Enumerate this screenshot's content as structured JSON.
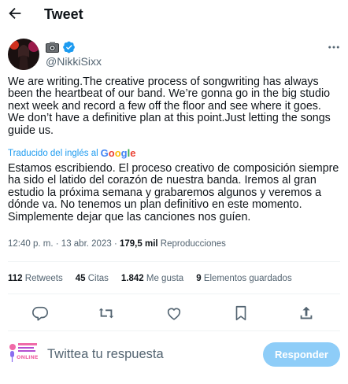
{
  "header": {
    "title": "Tweet"
  },
  "author": {
    "handle": "@NikkiSixx"
  },
  "tweet": {
    "text": "We are writing.The creative process of songwriting has always been the heartbeat of our band. We’re gonna go in the big studio next week and record a few off the floor and see where it goes. We don’t have a definitive plan at this point.Just letting the songs guide us.",
    "translated_label": "Traducido del inglés al",
    "translator": "Google",
    "translation": "Estamos escribiendo. El proceso creativo de composición siempre ha sido el latido del corazón de nuestra banda. Iremos al gran estudio la próxima semana y grabaremos algunos y veremos a dónde va. No tenemos un plan definitivo en este momento. Simplemente dejar que las canciones nos guíen."
  },
  "meta": {
    "time": "12:40 p. m.",
    "separator": "·",
    "date": "13 abr. 2023",
    "views_count": "179,5 mil",
    "views_label": "Reproducciones"
  },
  "stats": {
    "retweets_count": "112",
    "retweets_label": "Retweets",
    "quotes_count": "45",
    "quotes_label": "Citas",
    "likes_count": "1.842",
    "likes_label": "Me gusta",
    "bookmarks_count": "9",
    "bookmarks_label": "Elementos guardados"
  },
  "reply": {
    "placeholder": "Twittea tu respuesta",
    "button_label": "Responder",
    "avatar_text": "ONLINE"
  },
  "colors": {
    "accent": "#1d9bf0",
    "muted": "#536471",
    "reply_button": "#8ecdf8"
  },
  "icons": [
    "back-arrow-icon",
    "camera-icon",
    "verified-badge-icon",
    "more-icon",
    "reply-icon",
    "retweet-icon",
    "like-icon",
    "bookmark-icon",
    "share-icon"
  ]
}
